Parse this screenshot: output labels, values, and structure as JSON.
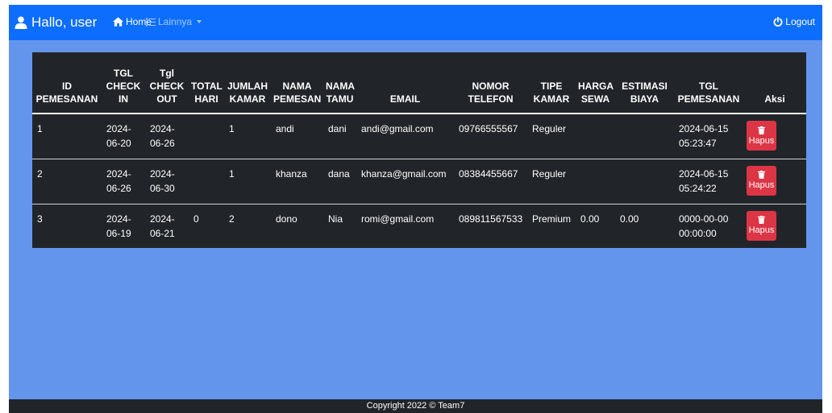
{
  "nav": {
    "brand": "Hallo, user",
    "home": "Home",
    "more": "Lainnya",
    "logout": "Logout"
  },
  "table": {
    "headers": {
      "id": [
        "ID",
        "PEMESANAN"
      ],
      "checkin": [
        "TGL",
        "CHECK",
        "IN"
      ],
      "checkout": [
        "Tgl",
        "CHECK",
        "OUT"
      ],
      "total_hari": [
        "TOTAL",
        "HARI"
      ],
      "jumlah_kamar": [
        "JUMLAH",
        "KAMAR"
      ],
      "nama_pemesan": [
        "NAMA",
        "PEMESAN"
      ],
      "nama_tamu": [
        "NAMA",
        "TAMU"
      ],
      "email": [
        "EMAIL"
      ],
      "nomor_telefon": [
        "NOMOR",
        "TELEFON"
      ],
      "tipe_kamar": [
        "TIPE",
        "KAMAR"
      ],
      "harga_sewa": [
        "HARGA",
        "SEWA"
      ],
      "estimasi_biaya": [
        "ESTIMASI",
        "BIAYA"
      ],
      "tgl_pemesanan": [
        "TGL",
        "PEMESANAN"
      ],
      "aksi": [
        "Aksi"
      ]
    },
    "rows": [
      {
        "id": "1",
        "checkin": [
          "2024-",
          "06-20"
        ],
        "checkout": [
          "2024-",
          "06-26"
        ],
        "total_hari": "",
        "jumlah_kamar": "1",
        "nama_pemesan": "andi",
        "nama_tamu": "dani",
        "email": "andi@gmail.com",
        "telefon": "09766555567",
        "tipe_kamar": "Reguler",
        "harga_sewa": "",
        "estimasi_biaya": "",
        "tgl_pemesanan": [
          "2024-06-15",
          "05:23:47"
        ],
        "aksi": "Hapus"
      },
      {
        "id": "2",
        "checkin": [
          "2024-",
          "06-26"
        ],
        "checkout": [
          "2024-",
          "06-30"
        ],
        "total_hari": "",
        "jumlah_kamar": "1",
        "nama_pemesan": "khanza",
        "nama_tamu": "dana",
        "email": "khanza@gmail.com",
        "telefon": "08384455667",
        "tipe_kamar": "Reguler",
        "harga_sewa": "",
        "estimasi_biaya": "",
        "tgl_pemesanan": [
          "2024-06-15",
          "05:24:22"
        ],
        "aksi": "Hapus"
      },
      {
        "id": "3",
        "checkin": [
          "2024-",
          "06-19"
        ],
        "checkout": [
          "2024-",
          "06-21"
        ],
        "total_hari": "0",
        "jumlah_kamar": "2",
        "nama_pemesan": "dono",
        "nama_tamu": "Nia",
        "email": "romi@gmail.com",
        "telefon": "089811567533",
        "tipe_kamar": "Premium",
        "harga_sewa": "0.00",
        "estimasi_biaya": "0.00",
        "tgl_pemesanan": [
          "0000-00-00",
          "00:00:00"
        ],
        "aksi": "Hapus"
      }
    ]
  },
  "footer": {
    "copyright": "Copyright 2022 © Team7"
  },
  "icons": {
    "user": "user-icon",
    "home": "home-icon",
    "list": "list-icon",
    "logout": "power-icon",
    "delete": "trash-icon"
  },
  "colors": {
    "navbar": "#0d6efd",
    "background": "#6495ed",
    "table": "#212529",
    "danger": "#dc3545"
  }
}
